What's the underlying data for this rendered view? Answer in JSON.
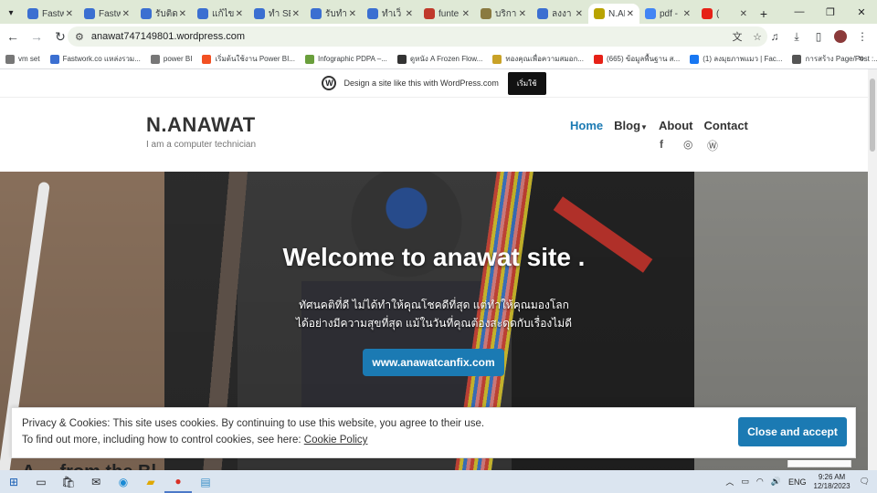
{
  "browser": {
    "tabs": [
      {
        "title": "Fastw",
        "color": "#3b6fd1"
      },
      {
        "title": "Fastw",
        "color": "#3b6fd1"
      },
      {
        "title": "รับติด",
        "color": "#3b6fd1"
      },
      {
        "title": "แก้ไข",
        "color": "#3b6fd1"
      },
      {
        "title": "ทำ SE",
        "color": "#3b6fd1"
      },
      {
        "title": "รับทำ",
        "color": "#3b6fd1"
      },
      {
        "title": "ทำเว็",
        "color": "#3b6fd1"
      },
      {
        "title": "funte",
        "color": "#c0392b"
      },
      {
        "title": "บริการ",
        "color": "#8a7a40"
      },
      {
        "title": "ลงงา",
        "color": "#3b6fd1"
      },
      {
        "title": "N.AN",
        "color": "#b8a300"
      },
      {
        "title": "pdf -",
        "color": "#4285f4"
      },
      {
        "title": "(",
        "color": "#e62117"
      }
    ],
    "active_tab_index": 10,
    "url": "anawat747149801.wordpress.com",
    "bookmarks": [
      {
        "label": "vm set",
        "icon": "folder-icon"
      },
      {
        "label": "Fastwork.co แหล่งรวม...",
        "icon": "fastwork-icon"
      },
      {
        "label": "power BI",
        "icon": "folder-icon"
      },
      {
        "label": "เริ่มต้นใช้งาน Power BI...",
        "icon": "microsoft-icon"
      },
      {
        "label": "Infographic PDPA –...",
        "icon": "pdpa-icon"
      },
      {
        "label": "ดูหนัง A Frozen Flow...",
        "icon": "movie-icon"
      },
      {
        "label": "ทองคุณเพื่อความสมอก...",
        "icon": "gold-icon"
      },
      {
        "label": "(665) ข้อมูลพื้นฐาน ส...",
        "icon": "youtube-icon"
      },
      {
        "label": "(1) ลงมุยภาพแมว | Fac...",
        "icon": "facebook-icon"
      },
      {
        "label": "การสร้าง Page/Post :...",
        "icon": "page-icon"
      }
    ]
  },
  "wpbar": {
    "text": "Design a site like this with WordPress.com",
    "button": "เริ่มใช้"
  },
  "site": {
    "title": "N.ANAWAT",
    "description": "I am a computer technician",
    "nav": [
      "Home",
      "Blog",
      "About",
      "Contact"
    ],
    "social_icons": [
      "facebook-icon",
      "instagram-icon",
      "wordpress-icon"
    ]
  },
  "hero": {
    "title": "Welcome to anawat site .",
    "line1": "ทัศนคติที่ดี ไม่ได้ทำให้คุณโชคดีที่สุด แต่ทำให้คุณมองโลก",
    "line2": "ได้อย่างมีความสุขที่สุด แม้ในวันที่คุณต้องสะดุดกับเรื่องไม่ดี",
    "button": "www.anawatcanfix.com"
  },
  "below_title": "A ... from the Bl...",
  "cookie": {
    "line1": "Privacy & Cookies: This site uses cookies. By continuing to use this website, you agree to their use.",
    "line2_prefix": "To find out more, including how to control cookies, see here: ",
    "link": "Cookie Policy",
    "button": "Close and accept"
  },
  "taskbar": {
    "lang": "ENG",
    "time": "9:26 AM",
    "date": "12/18/2023"
  }
}
